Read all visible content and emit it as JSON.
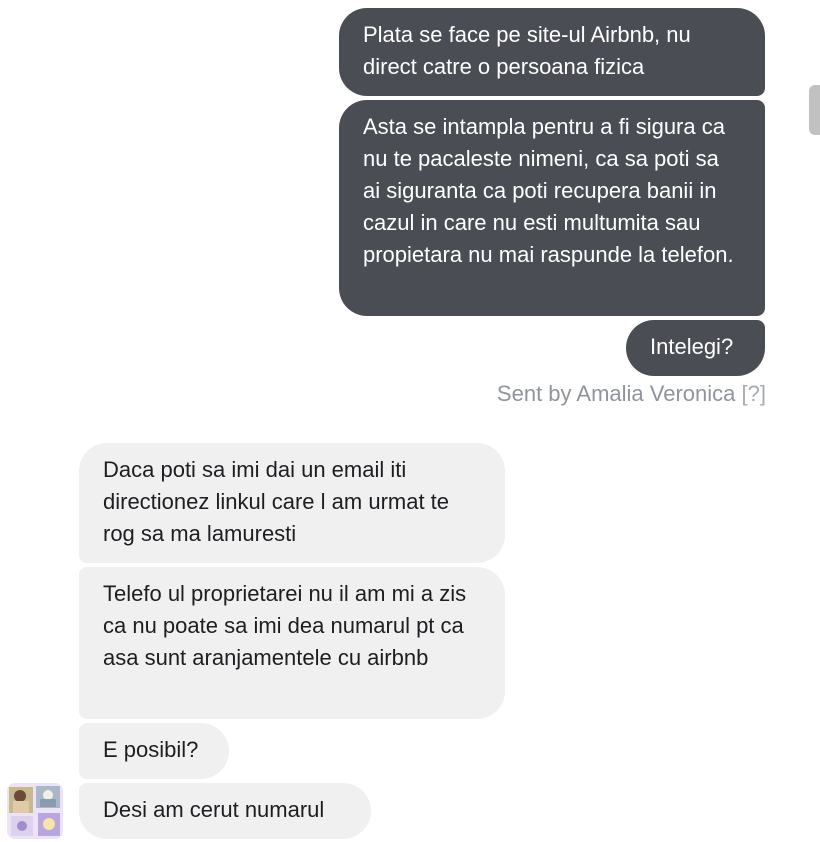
{
  "conversation": {
    "outgoing": [
      "Plata se face pe site-ul Airbnb, nu direct catre o persoana fizica",
      "Asta se intampla pentru a fi sigura ca nu te pacaleste nimeni, ca sa poti sa ai siguranta ca poti recupera banii in cazul in care nu esti multumita sau propietara nu mai raspunde la telefon.",
      "Intelegi?"
    ],
    "sent_by": "Sent by Amalia Veronica",
    "sent_by_help": "[?]",
    "incoming": [
      "Daca poti sa imi dai un email iti directionez linkul care l am urmat te rog sa ma lamuresti",
      "Telefo ul proprietarei nu il am mi a zis ca nu poate sa imi dea numarul pt ca asa sunt aranjamentele cu airbnb",
      "E posibil?",
      "Desi am cerut numarul"
    ]
  },
  "colors": {
    "outgoing_bubble": "#4a4d53",
    "incoming_bubble": "#f1f0f0",
    "meta_text": "#90949c"
  },
  "icons": {
    "contact_avatar": "avatar-photo"
  }
}
